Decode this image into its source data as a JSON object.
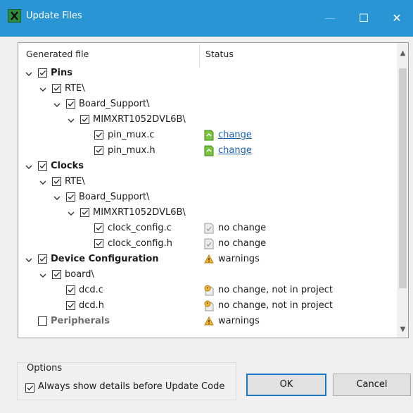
{
  "window": {
    "title": "Update Files",
    "minimize_glyph": "—",
    "maximize_glyph": "☐",
    "close_glyph": "✕",
    "app_icon": "x-logo-icon"
  },
  "table": {
    "col_file": "Generated file",
    "col_status": "Status",
    "rows": [
      {
        "label": "Pins",
        "bold": true,
        "status": "",
        "status_icon": ""
      },
      {
        "label": "RTE\\",
        "bold": false,
        "status": "",
        "status_icon": ""
      },
      {
        "label": "Board_Support\\",
        "bold": false,
        "status": "",
        "status_icon": ""
      },
      {
        "label": "MIMXRT1052DVL6B\\",
        "bold": false,
        "status": "",
        "status_icon": ""
      },
      {
        "label": "pin_mux.c",
        "bold": false,
        "status": "change",
        "status_icon": "change-file-icon"
      },
      {
        "label": "pin_mux.h",
        "bold": false,
        "status": "change",
        "status_icon": "change-file-icon"
      },
      {
        "label": "Clocks",
        "bold": true,
        "status": "",
        "status_icon": ""
      },
      {
        "label": "RTE\\",
        "bold": false,
        "status": "",
        "status_icon": ""
      },
      {
        "label": "Board_Support\\",
        "bold": false,
        "status": "",
        "status_icon": ""
      },
      {
        "label": "MIMXRT1052DVL6B\\",
        "bold": false,
        "status": "",
        "status_icon": ""
      },
      {
        "label": "clock_config.c",
        "bold": false,
        "status": "no change",
        "status_icon": "no-change-file-icon"
      },
      {
        "label": "clock_config.h",
        "bold": false,
        "status": "no change",
        "status_icon": "no-change-file-icon"
      },
      {
        "label": "Device Configuration",
        "bold": true,
        "status": "warnings",
        "status_icon": "warning-icon"
      },
      {
        "label": "board\\",
        "bold": false,
        "status": "",
        "status_icon": ""
      },
      {
        "label": "dcd.c",
        "bold": false,
        "status": "no change, not in project",
        "status_icon": "not-in-project-icon"
      },
      {
        "label": "dcd.h",
        "bold": false,
        "status": "no change, not in project",
        "status_icon": "not-in-project-icon"
      },
      {
        "label": "Peripherals",
        "bold": true,
        "status": "warnings",
        "status_icon": "warning-icon"
      }
    ]
  },
  "options": {
    "legend": "Options",
    "always_show_label": "Always show details before Update Code",
    "always_show_checked": true
  },
  "buttons": {
    "ok": "OK",
    "cancel": "Cancel"
  }
}
